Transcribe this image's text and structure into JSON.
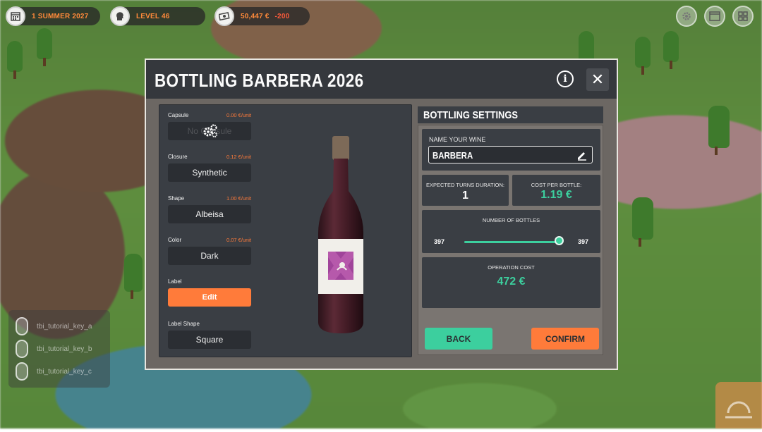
{
  "hud": {
    "date": "1 SUMMER 2027",
    "level": "LEVEL 46",
    "money": "50,447 €",
    "money_delta": "-200"
  },
  "tutorial": {
    "hint_a": "tbi_tutorial_key_a",
    "hint_b": "tbi_tutorial_key_b",
    "hint_c": "tbi_tutorial_key_c"
  },
  "modal": {
    "title": "BOTTLING BARBERA 2026"
  },
  "options": {
    "capsule_label": "Capsule",
    "capsule_price": "0.00 €/unit",
    "capsule_value": "No Capsule",
    "closure_label": "Closure",
    "closure_price": "0.12 €/unit",
    "closure_value": "Synthetic",
    "shape_label": "Shape",
    "shape_price": "1.00 €/unit",
    "shape_value": "Albeisa",
    "color_label": "Color",
    "color_price": "0.07 €/unit",
    "color_value": "Dark",
    "label_label": "Label",
    "label_button": "Edit",
    "label_shape_label": "Label Shape",
    "label_shape_value": "Square"
  },
  "settings": {
    "header": "BOTTLING SETTINGS",
    "name_label": "NAME YOUR WINE",
    "name_value": "BARBERA",
    "turns_label": "EXPECTED TURNS DURATION:",
    "turns_value": "1",
    "cost_label": "COST PER BOTTLE:",
    "cost_value": "1.19 €",
    "bottles_label": "NUMBER OF BOTTLES",
    "bottles_min": "397",
    "bottles_max": "397",
    "bottles_fraction": 1.0,
    "operation_label": "OPERATION COST",
    "operation_value": "472 €",
    "back_button": "BACK",
    "confirm_button": "CONFIRM"
  },
  "colors": {
    "accent_orange": "#ff7b3a",
    "accent_green": "#3ccf9e",
    "panel_dark": "#3a3e44",
    "wine_label_purple": "#a0449a"
  }
}
